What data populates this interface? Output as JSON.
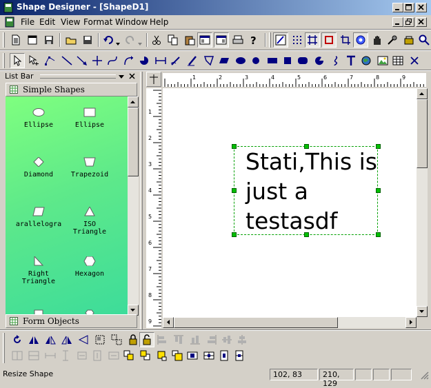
{
  "window": {
    "title": "Shape Designer - [ShapeD1]"
  },
  "menu": [
    "File",
    "Edit",
    "View",
    "Format",
    "Window",
    "Help"
  ],
  "toolbar_main": [
    "new-icon",
    "open-icon",
    "save-icon",
    "open-folder-icon",
    "save-as-icon",
    "save-disk-icon",
    "undo-icon",
    "redo-icon",
    "cut-icon",
    "copy-icon",
    "paste-icon",
    "properties-icon",
    "layout-icon",
    "print-icon",
    "help-icon",
    "design-mode-icon",
    "grid-icon",
    "snap-icon",
    "select-frame-icon",
    "crop-icon",
    "flower-icon",
    "hand-icon",
    "tools-icon",
    "zoom-icon"
  ],
  "toolbar_draw": [
    "pointer-icon",
    "pointer-plus-icon",
    "polyline-icon",
    "line-icon",
    "arrow-icon",
    "cross-icon",
    "bezier-icon",
    "curve-icon",
    "arc-icon",
    "dimension-icon",
    "pencil-icon",
    "pen-icon",
    "freeform-icon",
    "parallelogram-icon",
    "ellipse-icon",
    "circle-icon",
    "rectangle-icon",
    "square-icon",
    "rounded-rect-icon",
    "pie-icon",
    "spiral-icon",
    "text-icon",
    "globe-icon",
    "image-icon",
    "table-icon",
    "x-icon"
  ],
  "listbar": {
    "title": "List Bar",
    "group1": "Simple Shapes",
    "group2": "Form Objects",
    "shapes": [
      {
        "label": "Ellipse",
        "icon": "ellipse-shape"
      },
      {
        "label": "Ellipse",
        "icon": "rect-shape"
      },
      {
        "label": "Diamond",
        "icon": "diamond-shape"
      },
      {
        "label": "Trapezoid",
        "icon": "trapezoid-shape"
      },
      {
        "label": "arallelogra",
        "icon": "parallelogram-shape"
      },
      {
        "label": "ISO\nTriangle",
        "icon": "triangle-shape"
      },
      {
        "label": "Right\nTriangle",
        "icon": "right-triangle-shape"
      },
      {
        "label": "Hexagon",
        "icon": "hexagon-shape"
      }
    ]
  },
  "canvas": {
    "text_lines": [
      "Stati,This is",
      "just a",
      "testasdf"
    ]
  },
  "ruler": {
    "h_labels": [
      "1",
      "2",
      "3",
      "4",
      "5",
      "6",
      "7",
      "8",
      "9"
    ],
    "v_labels": [
      "1",
      "2",
      "3",
      "4",
      "5",
      "6",
      "7",
      "8",
      "9"
    ]
  },
  "toolbar_align_row1": [
    "rotate-icon",
    "flip-left-icon",
    "flip-right-icon",
    "flip-v-icon",
    "flip-h-icon",
    "group-icon",
    "ungroup-icon",
    "lock-icon",
    "unlock-icon",
    "align-left-icon",
    "align-top-icon",
    "align-bottom-icon",
    "align-right-icon",
    "center-h-icon",
    "center-v-icon"
  ],
  "toolbar_align_row2": [
    "space-across-icon",
    "space-down-icon",
    "same-width-icon",
    "same-height-icon",
    "same-size-icon",
    "center-page-h-icon",
    "center-page-v-icon",
    "bring-front-icon",
    "send-back-icon",
    "bring-forward-icon",
    "send-backward-icon",
    "order1-icon",
    "order2-icon",
    "order3-icon"
  ],
  "status": {
    "message": "Resize Shape",
    "position": "102, 83",
    "size": "210, 129"
  },
  "colors": {
    "title_start": "#0a246a",
    "title_end": "#a6caf0",
    "panel_green": "#5ee98a",
    "selection": "#00a000"
  }
}
